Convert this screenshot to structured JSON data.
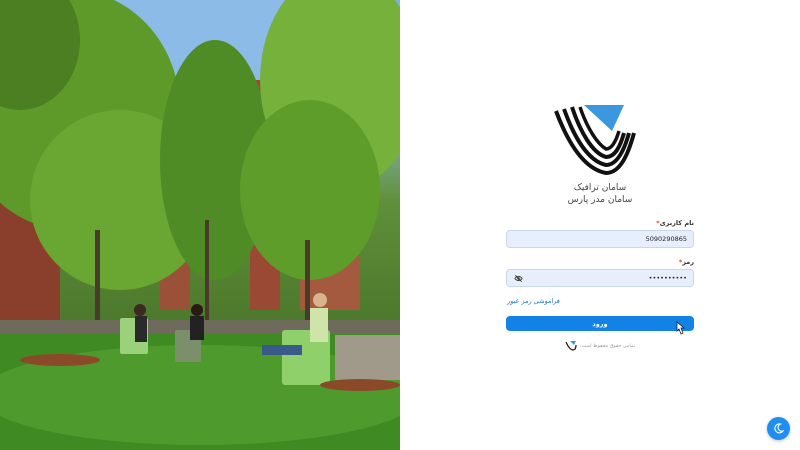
{
  "brand": {
    "line1": "سامان ترافیک",
    "line2": "سامان مدر پارس"
  },
  "form": {
    "username": {
      "label": "نام کاربری",
      "required_mark": "*",
      "value": "5090290865"
    },
    "password": {
      "label": "رمز",
      "required_mark": "*",
      "value": "••••••••••"
    },
    "forgot_link": "فراموشی رمز عبور",
    "submit_label": "ورود"
  },
  "footer": {
    "copyright": "تمامی حقوق محفوظ است."
  },
  "icons": {
    "logo": "saman-traffic-logo",
    "password_toggle": "eye-slash-icon",
    "theme_toggle": "moon-icon",
    "cursor": "mouse-pointer-icon"
  },
  "colors": {
    "primary": "#1282e6",
    "field_bg": "#e8effc",
    "required": "#e23b3b",
    "link": "#1a73d9",
    "logo_blue": "#3a98e0"
  }
}
